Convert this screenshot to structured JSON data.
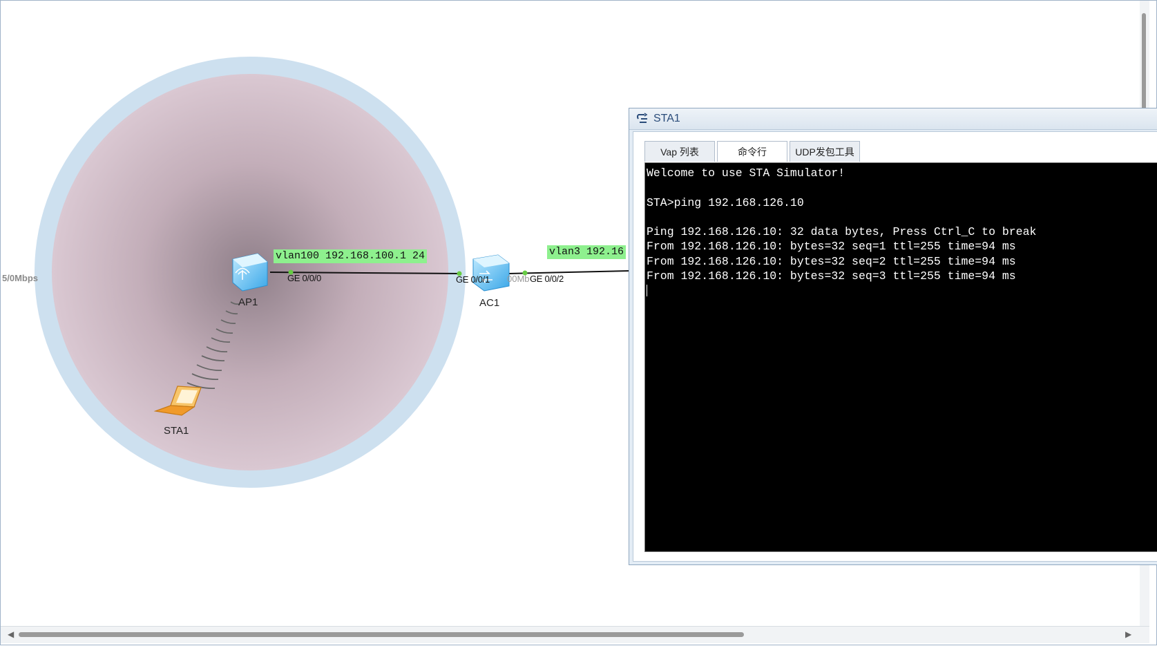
{
  "topology": {
    "devices": {
      "ap1": "AP1",
      "ac1": "AC1",
      "sta1": "STA1"
    },
    "ports": {
      "ap1_ge000": "GE 0/0/0",
      "ac1_ge001": "GE 0/0/1",
      "ac1_ge002": "GE 0/0/2"
    },
    "vlan_labels": {
      "ap1": "vlan100 192.168.100.1 24",
      "ac1": "vlan3 192.16"
    },
    "speeds": {
      "left_edge": "5/0Mbps",
      "ac1_right": "00Mb"
    },
    "colors": {
      "vlan_label_bg": "#8ef08e",
      "coverage_outer": "#cde0ef",
      "coverage_inner": "#d9c6d0",
      "sta_laptop": "#f0a040"
    }
  },
  "sta_window": {
    "title": "STA1",
    "tabs": [
      "Vap 列表",
      "命令行",
      "UDP发包工具"
    ],
    "active_tab": "命令行",
    "terminal_lines": [
      "Welcome to use STA Simulator!",
      "",
      "STA>ping 192.168.126.10",
      "",
      "Ping 192.168.126.10: 32 data bytes, Press Ctrl_C to break",
      "From 192.168.126.10: bytes=32 seq=1 ttl=255 time=94 ms",
      "From 192.168.126.10: bytes=32 seq=2 ttl=255 time=94 ms",
      "From 192.168.126.10: bytes=32 seq=3 ttl=255 time=94 ms"
    ]
  }
}
